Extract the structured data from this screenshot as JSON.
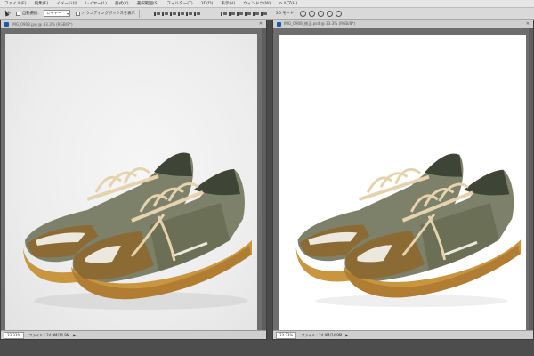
{
  "menu": {
    "items": [
      "ファイル(F)",
      "編集(E)",
      "イメージ(I)",
      "レイヤー(L)",
      "書式(Y)",
      "選択範囲(S)",
      "フィルター(T)",
      "3D(D)",
      "表示(V)",
      "ウィンドウ(W)",
      "ヘルプ(H)"
    ]
  },
  "options": {
    "auto_select_label": "自動選択：",
    "auto_select_value": "レイヤー",
    "transform_label": "バウンディングボックスを表示",
    "mode3d_label": "3D モード："
  },
  "doc_left": {
    "title": "IMG_0908.jpg @ 33.3% (RGB/8*)",
    "zoom": "33.33%",
    "status": "ファイル : 24.9M/24.9M"
  },
  "doc_right": {
    "title": "IMG_0908_修正.psd @ 33.3% (RGB/8*)",
    "zoom": "33.33%",
    "status": "ファイル : 24.9M/24.9M"
  },
  "colors": {
    "app_bg": "#535353",
    "menu_bg": "#e6e6e6",
    "shoe_suede": "#8b6a34",
    "shoe_sole": "#c9953f",
    "shoe_mesh": "#7d816a",
    "shoe_dark": "#3e4436",
    "laces": "#e6d3ae"
  },
  "icons": {
    "move_tool": "move-tool-icon",
    "close": "close-icon",
    "doc": "document-icon"
  }
}
